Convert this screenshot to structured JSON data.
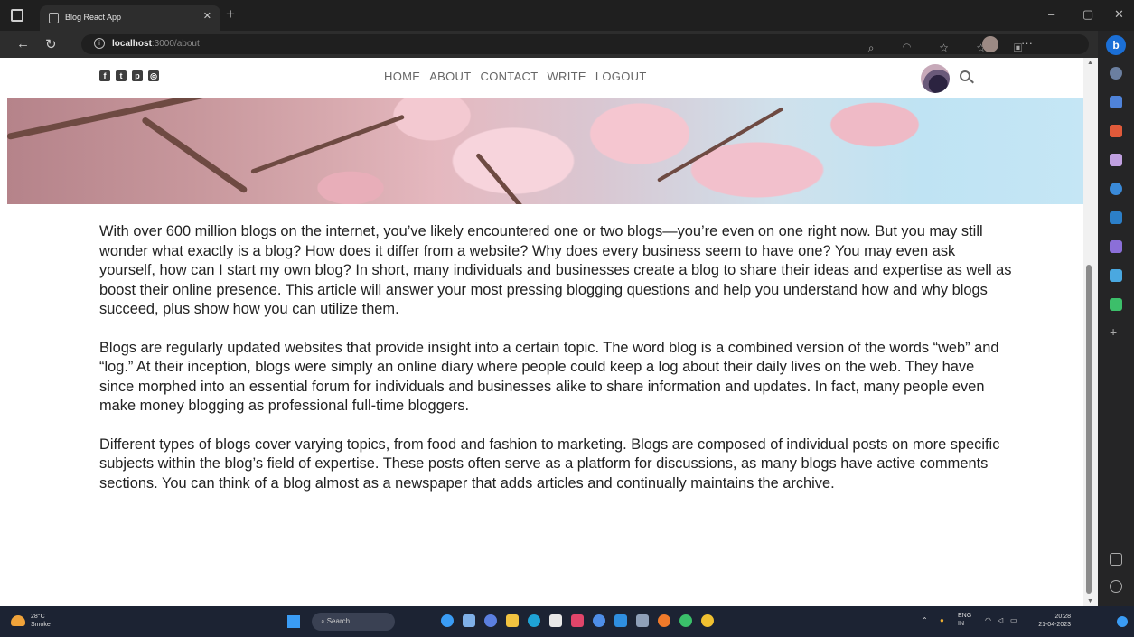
{
  "browser": {
    "tab_title": "Blog React App",
    "url_host": "localhost",
    "url_path": ":3000/about",
    "sidebar_button": "b"
  },
  "site": {
    "social_icons": [
      "facebook-icon",
      "twitter-icon",
      "pinterest-icon",
      "instagram-icon"
    ],
    "menu": [
      "HOME",
      "ABOUT",
      "CONTACT",
      "WRITE",
      "LOGOUT"
    ]
  },
  "article": {
    "paragraphs": [
      "With over 600 million blogs on the internet, you’ve likely encountered one or two blogs—you’re even on one right now. But you may still wonder what exactly is a blog? How does it differ from a website? Why does every business seem to have one? You may even ask yourself, how can I start my own blog? In short, many individuals and businesses create a blog to share their ideas and expertise as well as boost their online presence. This article will answer your most pressing blogging questions and help you understand how and why blogs succeed, plus show how you can utilize them.",
      "Blogs are regularly updated websites that provide insight into a certain topic. The word blog is a combined version of the words “web” and “log.” At their inception, blogs were simply an online diary where people could keep a log about their daily lives on the web. They have since morphed into an essential forum for individuals and businesses alike to share information and updates. In fact, many people even make money blogging as professional full-time bloggers.",
      "Different types of blogs cover varying topics, from food and fashion to marketing. Blogs are composed of individual posts on more specific subjects within the blog’s field of expertise. These posts often serve as a platform for discussions, as many blogs have active comments sections. You can think of a blog almost as a newspaper that adds articles and continually maintains the archive."
    ]
  },
  "taskbar": {
    "weather_temp": "28°C",
    "weather_desc": "Smoke",
    "search_label": "Search",
    "lang_top": "ENG",
    "lang_bottom": "IN",
    "time": "20:28",
    "date": "21-04-2023"
  },
  "colors": {
    "page_bg": "#ffffff",
    "menu_text": "#666666",
    "body_text": "#222222",
    "taskbar": "#1c2333"
  }
}
